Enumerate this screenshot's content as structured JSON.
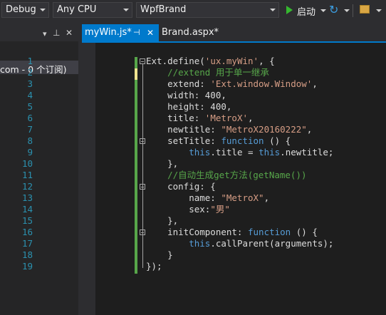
{
  "toolbar": {
    "config": "Debug",
    "platform": "Any CPU",
    "startup_project": "WpfBrand",
    "start_label": "启动"
  },
  "left_panel": {
    "pin_glyph": "▾ ⊥",
    "close_glyph": "✕",
    "item": "com - 0 个订阅)"
  },
  "tabs": [
    {
      "label": "myWin.js*",
      "active": true
    },
    {
      "label": "Brand.aspx*",
      "active": false
    }
  ],
  "tab_glyphs": {
    "pin": "⊣",
    "close": "✕"
  },
  "line_numbers": [
    "1",
    "2",
    "3",
    "4",
    "5",
    "6",
    "7",
    "8",
    "9",
    "10",
    "11",
    "12",
    "13",
    "14",
    "15",
    "16",
    "17",
    "18",
    "19"
  ],
  "code": {
    "l1": {
      "a": "Ext.define(",
      "b": "'ux.myWin'",
      "c": ", {"
    },
    "l2": {
      "a": "    //extend 用于单一继承"
    },
    "l3": {
      "a": "    extend: ",
      "b": "'Ext.window.Window'",
      "c": ","
    },
    "l4": {
      "a": "    width: 400,"
    },
    "l5": {
      "a": "    height: 400,"
    },
    "l6": {
      "a": "    title: ",
      "b": "'MetroX'",
      "c": ","
    },
    "l7": {
      "a": "    newtitle: ",
      "b": "\"MetroX20160222\"",
      "c": ","
    },
    "l8": {
      "a": "    setTitle: ",
      "b": "function",
      "c": " () {"
    },
    "l9": {
      "a": "        ",
      "b": "this",
      "c": ".title = ",
      "d": "this",
      "e": ".newtitle;"
    },
    "l10": {
      "a": "    },"
    },
    "l11": {
      "a": "    //自动生成get方法(getName())"
    },
    "l12": {
      "a": "    config: {"
    },
    "l13": {
      "a": "        name: ",
      "b": "\"MetroX\"",
      "c": ","
    },
    "l14": {
      "a": "        sex:",
      "b": "\"男\""
    },
    "l15": {
      "a": "    },"
    },
    "l16": {
      "a": "    initComponent: ",
      "b": "function",
      "c": " () {"
    },
    "l17": {
      "a": "        ",
      "b": "this",
      "c": ".callParent(arguments);"
    },
    "l18": {
      "a": "    }"
    },
    "l19": {
      "a": "});"
    }
  }
}
